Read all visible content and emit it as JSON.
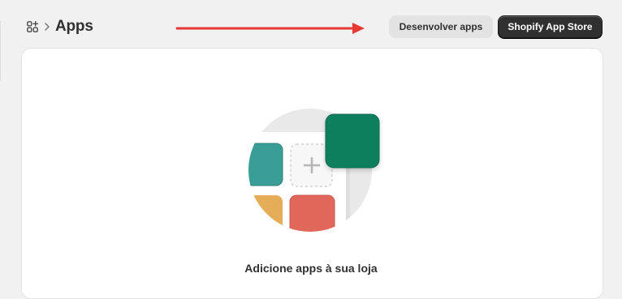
{
  "header": {
    "title": "Apps",
    "icon": "apps-grid-icon",
    "separator_icon": "chevron-right-icon",
    "arrow_color": "#e53935"
  },
  "actions": {
    "secondary_label": "Desenvolver apps",
    "primary_label": "Shopify App Store"
  },
  "empty_state": {
    "illustration": "app-tiles-illustration",
    "title": "Adicione apps à sua loja",
    "tile_colors": {
      "teal": "#389e96",
      "green": "#0e7f5d",
      "red": "#e0675a",
      "yellow": "#e6ad58"
    }
  }
}
